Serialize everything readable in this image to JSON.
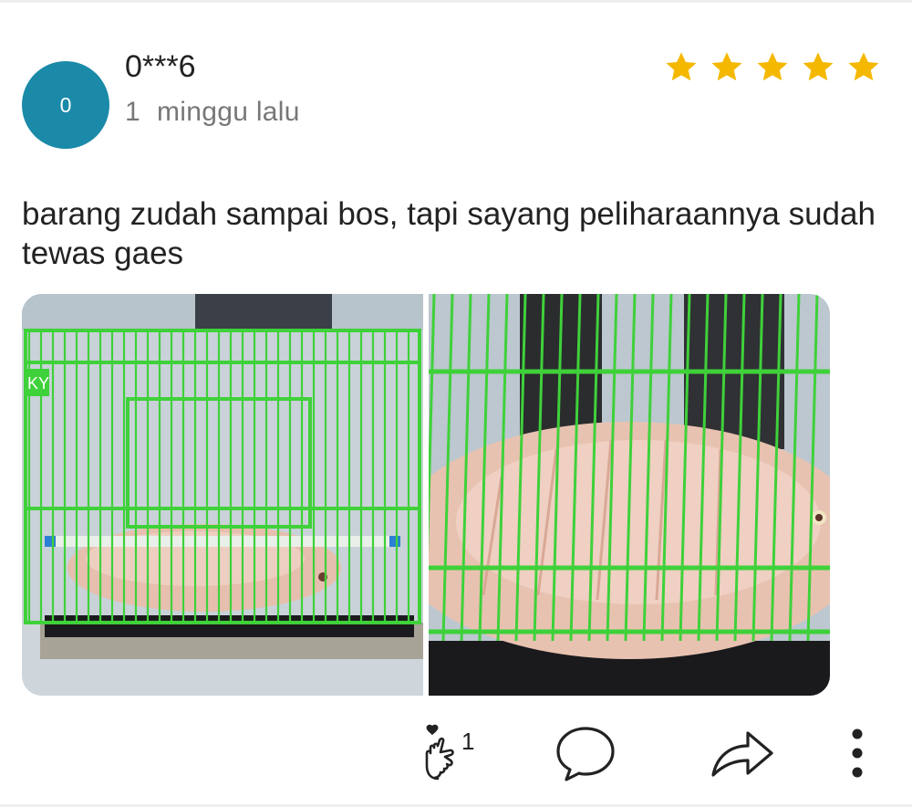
{
  "review": {
    "avatar_letter": "0",
    "username": "0***6",
    "time_number": "1",
    "time_unit": "minggu lalu",
    "rating": 5,
    "text": "barang zudah sampai bos, tapi sayang peliharaannya sudah tewas gaes"
  },
  "photos": [
    {
      "name": "fish-in-cage-photo-1",
      "cage_label": "KY"
    },
    {
      "name": "fish-in-cage-photo-2"
    }
  ],
  "actions": {
    "like_count": "1",
    "icons": [
      "finger-heart-icon",
      "comment-icon",
      "share-icon",
      "more-icon"
    ]
  },
  "colors": {
    "avatar": "#1a8aa8",
    "star": "#f5b800",
    "cage": "#3fd13a"
  }
}
